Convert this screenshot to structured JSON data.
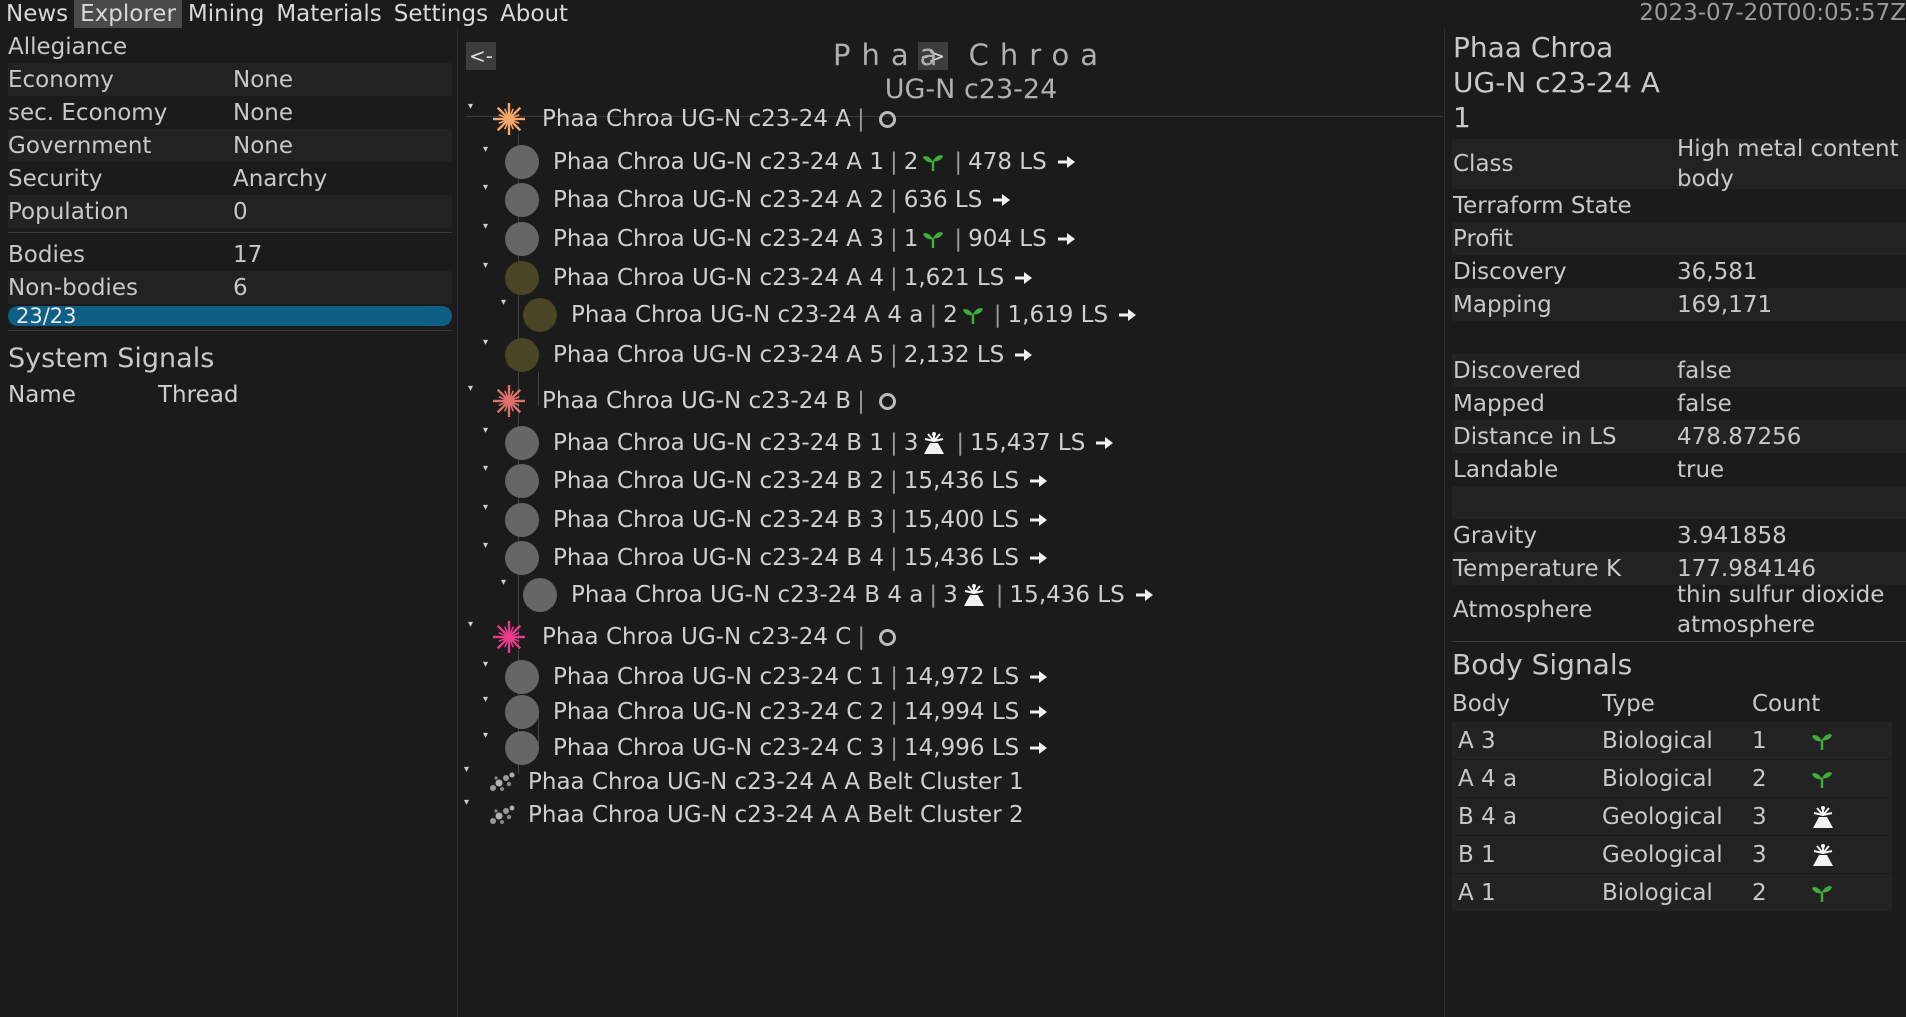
{
  "menu": [
    "News",
    "Explorer",
    "Mining",
    "Materials",
    "Settings",
    "About"
  ],
  "clock": "2023-07-20T00:05:57Z",
  "left": {
    "info": [
      {
        "k": "Allegiance",
        "v": ""
      },
      {
        "k": "Economy",
        "v": "None"
      },
      {
        "k": "sec. Economy",
        "v": "None"
      },
      {
        "k": "Government",
        "v": "None"
      },
      {
        "k": "Security",
        "v": "Anarchy"
      },
      {
        "k": "Population",
        "v": "0"
      }
    ],
    "counts": [
      {
        "k": "Bodies",
        "v": "17"
      },
      {
        "k": "Non-bodies",
        "v": "6"
      }
    ],
    "progress_label": "23/23",
    "progress_fraction": 1.0,
    "signals_title": "System Signals",
    "signals_cols": [
      "Name",
      "Thread"
    ]
  },
  "center": {
    "prev_label": "<-",
    "next_label": "->",
    "system_name": "Phaa Chroa",
    "system_sub": "UG-N c23-24",
    "rows": [
      {
        "label": "Phaa Chroa UG-N c23-24 A",
        "kind": "star",
        "color": "#f5a86a"
      },
      {
        "label": "Phaa Chroa UG-N c23-24 A 1",
        "kind": "body",
        "count": "2",
        "signal": "bio",
        "dist": "478 LS"
      },
      {
        "label": "Phaa Chroa UG-N c23-24 A 2",
        "kind": "body",
        "dist": "636 LS"
      },
      {
        "label": "Phaa Chroa UG-N c23-24 A 3",
        "kind": "body",
        "count": "1",
        "signal": "bio",
        "dist": "904 LS"
      },
      {
        "label": "Phaa Chroa UG-N c23-24 A 4",
        "kind": "ice",
        "dist": "1,621 LS"
      },
      {
        "label": "Phaa Chroa UG-N c23-24 A 4 a",
        "kind": "ice",
        "count": "2",
        "signal": "bio",
        "dist": "1,619 LS"
      },
      {
        "label": "Phaa Chroa UG-N c23-24 A 5",
        "kind": "ice",
        "dist": "2,132 LS"
      },
      {
        "label": "Phaa Chroa UG-N c23-24 B",
        "kind": "star",
        "color": "#e0706a"
      },
      {
        "label": "Phaa Chroa UG-N c23-24 B 1",
        "kind": "body",
        "count": "3",
        "signal": "geo",
        "dist": "15,437 LS"
      },
      {
        "label": "Phaa Chroa UG-N c23-24 B 2",
        "kind": "body",
        "dist": "15,436 LS"
      },
      {
        "label": "Phaa Chroa UG-N c23-24 B 3",
        "kind": "body",
        "dist": "15,400 LS"
      },
      {
        "label": "Phaa Chroa UG-N c23-24 B 4",
        "kind": "body",
        "dist": "15,436 LS"
      },
      {
        "label": "Phaa Chroa UG-N c23-24 B 4 a",
        "kind": "body",
        "count": "3",
        "signal": "geo",
        "dist": "15,436 LS"
      },
      {
        "label": "Phaa Chroa UG-N c23-24 C",
        "kind": "star",
        "color": "#e83a8a"
      },
      {
        "label": "Phaa Chroa UG-N c23-24 C 1",
        "kind": "body",
        "dist": "14,972 LS"
      },
      {
        "label": "Phaa Chroa UG-N c23-24 C 2",
        "kind": "body",
        "dist": "14,994 LS"
      },
      {
        "label": "Phaa Chroa UG-N c23-24 C 3",
        "kind": "body",
        "dist": "14,996 LS"
      },
      {
        "label": "Phaa Chroa UG-N c23-24 A A Belt Cluster 1",
        "kind": "belt"
      },
      {
        "label": "Phaa Chroa UG-N c23-24 A A Belt Cluster 2",
        "kind": "belt"
      }
    ]
  },
  "right": {
    "title_lines": [
      "Phaa Chroa",
      "UG-N c23-24 A",
      "1"
    ],
    "props": [
      {
        "k": "Class",
        "v": "High metal content body"
      },
      {
        "k": "Terraform State",
        "v": ""
      },
      {
        "k": "Profit",
        "v": ""
      },
      {
        "k": "Discovery",
        "v": "36,581"
      },
      {
        "k": "Mapping",
        "v": "169,171"
      },
      {
        "k": "",
        "v": ""
      },
      {
        "k": "Discovered",
        "v": "false"
      },
      {
        "k": "Mapped",
        "v": "false"
      },
      {
        "k": "Distance in LS",
        "v": "478.87256"
      },
      {
        "k": "Landable",
        "v": "true"
      },
      {
        "k": "",
        "v": ""
      },
      {
        "k": "Gravity",
        "v": "3.941858"
      },
      {
        "k": "Temperature K",
        "v": "177.984146"
      },
      {
        "k": "Atmosphere",
        "v": "thin sulfur dioxide atmosphere"
      }
    ],
    "signals_title": "Body Signals",
    "signals_cols": [
      "Body",
      "Type",
      "Count"
    ],
    "signals": [
      {
        "body": "A 3",
        "type": "Biological",
        "count": "1",
        "icon": "bio"
      },
      {
        "body": "A 4 a",
        "type": "Biological",
        "count": "2",
        "icon": "bio"
      },
      {
        "body": "B 4 a",
        "type": "Geological",
        "count": "3",
        "icon": "geo"
      },
      {
        "body": "B 1",
        "type": "Geological",
        "count": "3",
        "icon": "geo"
      },
      {
        "body": "A 1",
        "type": "Biological",
        "count": "2",
        "icon": "bio"
      }
    ]
  }
}
